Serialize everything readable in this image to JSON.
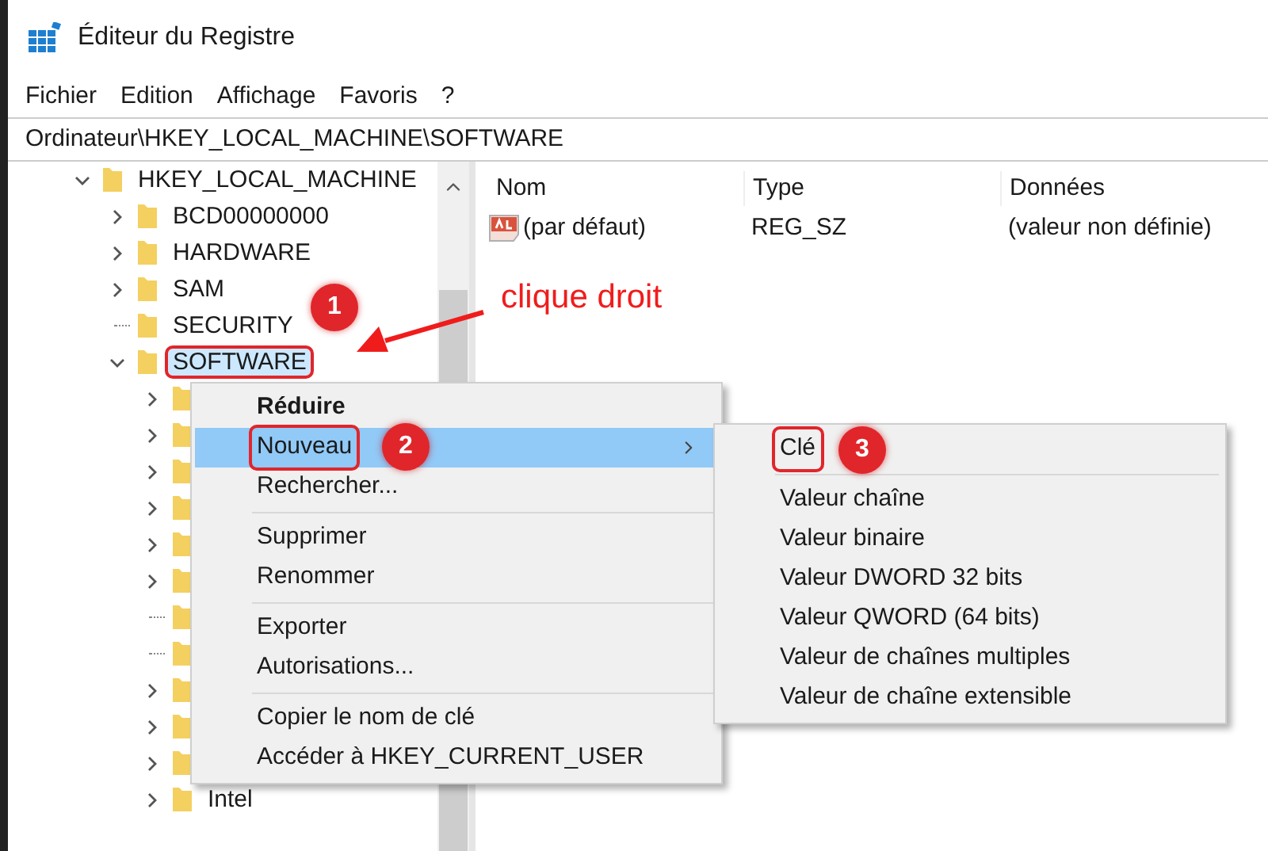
{
  "window": {
    "title": "Éditeur du Registre"
  },
  "menu_bar": [
    "Fichier",
    "Edition",
    "Affichage",
    "Favoris",
    "?"
  ],
  "address": "Ordinateur\\HKEY_LOCAL_MACHINE\\SOFTWARE",
  "tree": [
    {
      "label": "HKEY_LOCAL_MACHINE",
      "expanded": true,
      "has_children": true,
      "selected": false,
      "children": [
        {
          "label": "BCD00000000",
          "has_children": true,
          "selected": false
        },
        {
          "label": "HARDWARE",
          "has_children": true,
          "selected": false
        },
        {
          "label": "SAM",
          "has_children": true,
          "selected": false
        },
        {
          "label": "SECURITY",
          "has_children": false,
          "selected": false
        },
        {
          "label": "SOFTWARE",
          "expanded": true,
          "has_children": true,
          "selected": true,
          "outlined": true,
          "badge": "1",
          "children": [
            {
              "has_children": true,
              "selected": false
            },
            {
              "has_children": true,
              "selected": false
            },
            {
              "has_children": true,
              "selected": false
            },
            {
              "has_children": true,
              "selected": false
            },
            {
              "has_children": true,
              "selected": false
            },
            {
              "has_children": true,
              "selected": false
            },
            {
              "has_children": false,
              "selected": false
            },
            {
              "has_children": false,
              "selected": false
            },
            {
              "has_children": true,
              "selected": false
            },
            {
              "has_children": true,
              "selected": false
            },
            {
              "has_children": true,
              "selected": false
            },
            {
              "label": "Intel",
              "has_children": true,
              "selected": false
            }
          ]
        }
      ]
    }
  ],
  "values_table": {
    "columns": [
      "Nom",
      "Type",
      "Données"
    ],
    "rows": [
      {
        "name": "(par défaut)",
        "type": "REG_SZ",
        "data": "(valeur non définie)"
      }
    ]
  },
  "context_menu": {
    "items": [
      {
        "kind": "item",
        "label": "Réduire",
        "bold": true,
        "selected": false
      },
      {
        "kind": "item",
        "label": "Nouveau",
        "selected": true,
        "submenu": true,
        "outlined": true,
        "badge": "2"
      },
      {
        "kind": "item",
        "label": "Rechercher...",
        "selected": false
      },
      {
        "kind": "separator"
      },
      {
        "kind": "item",
        "label": "Supprimer",
        "selected": false
      },
      {
        "kind": "item",
        "label": "Renommer",
        "selected": false
      },
      {
        "kind": "separator"
      },
      {
        "kind": "item",
        "label": "Exporter",
        "selected": false
      },
      {
        "kind": "item",
        "label": "Autorisations...",
        "selected": false
      },
      {
        "kind": "separator"
      },
      {
        "kind": "item",
        "label": "Copier le nom de clé",
        "selected": false
      },
      {
        "kind": "item",
        "label": "Accéder à HKEY_CURRENT_USER",
        "selected": false
      }
    ]
  },
  "submenu": {
    "items": [
      {
        "kind": "item",
        "label": "Clé",
        "selected": false,
        "outlined": true,
        "badge": "3"
      },
      {
        "kind": "separator"
      },
      {
        "kind": "item",
        "label": "Valeur chaîne",
        "selected": false
      },
      {
        "kind": "item",
        "label": "Valeur binaire",
        "selected": false
      },
      {
        "kind": "item",
        "label": "Valeur DWORD 32 bits",
        "selected": false
      },
      {
        "kind": "item",
        "label": "Valeur QWORD (64 bits)",
        "selected": false
      },
      {
        "kind": "item",
        "label": "Valeur de chaînes multiples",
        "selected": false
      },
      {
        "kind": "item",
        "label": "Valeur de chaîne extensible",
        "selected": false
      }
    ]
  },
  "annotation": {
    "text": "clique droit"
  }
}
